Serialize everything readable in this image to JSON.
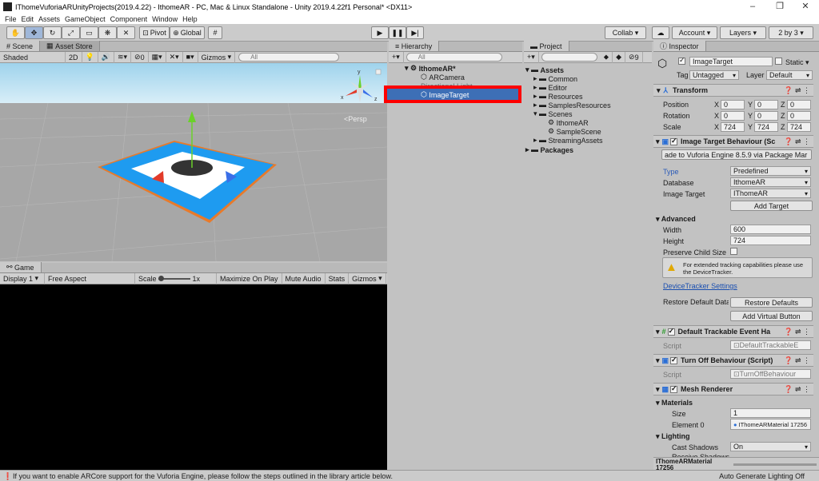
{
  "window": {
    "title": "IThomeVuforiaARUnityProjects(2019.4.22) - IthomeAR - PC, Mac & Linux Standalone - Unity 2019.4.22f1 Personal* <DX11>",
    "controls": [
      "–",
      "❐",
      "✕"
    ]
  },
  "menu": [
    "File",
    "Edit",
    "Assets",
    "GameObject",
    "Component",
    "Window",
    "Help"
  ],
  "toolbar": {
    "pivot": "Pivot",
    "global": "Global",
    "collab": "Collab ▾",
    "account": "Account",
    "layers": "Layers",
    "layout": "2 by 3"
  },
  "scene": {
    "tabs": [
      "Scene",
      "Asset Store"
    ],
    "shading": "Shaded",
    "mode2d": "2D",
    "gizmos": "Gizmos",
    "search_placeholder": "All",
    "persp": "<Persp",
    "fx_count": "0"
  },
  "game": {
    "tab": "Game",
    "display": "Display 1",
    "aspect": "Free Aspect",
    "scale_label": "Scale",
    "scale_value": "1x",
    "maximize": "Maximize On Play",
    "mute": "Mute Audio",
    "stats": "Stats",
    "gizmos": "Gizmos"
  },
  "hierarchy": {
    "tab": "Hierarchy",
    "search_placeholder": "All",
    "scene_name": "IthomeAR*",
    "items": [
      "ARCamera",
      "Directional Light",
      "ImageTarget"
    ]
  },
  "project": {
    "tab": "Project",
    "count": "9",
    "assets_label": "Assets",
    "folders": [
      "Common",
      "Editor",
      "Resources",
      "SamplesResources",
      "Scenes",
      "StreamingAssets"
    ],
    "scenes": [
      "IthomeAR",
      "SampleScene"
    ],
    "packages": "Packages"
  },
  "inspector": {
    "tab": "Inspector",
    "object_name": "ImageTarget",
    "static_label": "Static",
    "tag_label": "Tag",
    "tag_value": "Untagged",
    "layer_label": "Layer",
    "layer_value": "Default",
    "transform": {
      "title": "Transform",
      "rows": [
        {
          "label": "Position",
          "x": "0",
          "y": "0",
          "z": "0"
        },
        {
          "label": "Rotation",
          "x": "0",
          "y": "0",
          "z": "0"
        },
        {
          "label": "Scale",
          "x": "724",
          "y": "724",
          "z": "724"
        }
      ]
    },
    "itb": {
      "title": "Image Target Behaviour (Sc",
      "upgrade_text": "ade to Vuforia Engine 8.5.9 via Package Mar",
      "type_label": "Type",
      "type_value": "Predefined",
      "database_label": "Database",
      "database_value": "IthomeAR",
      "image_target_label": "Image Target",
      "image_target_value": "IThomeAR",
      "add_target": "Add Target",
      "advanced": "Advanced",
      "width_label": "Width",
      "width_value": "600",
      "height_label": "Height",
      "height_value": "724",
      "preserve_label": "Preserve Child Size",
      "warning": "For extended tracking capabilities please use the DeviceTracker.",
      "device_tracker_link": "DeviceTracker Settings",
      "restore_label": "Restore Default Data",
      "restore_button": "Restore Defaults",
      "add_virtual_button": "Add Virtual Button"
    },
    "dteh": {
      "title": "Default Trackable Event Ha",
      "script_label": "Script",
      "script_value": "DefaultTrackableE"
    },
    "tob": {
      "title": "Turn Off Behaviour (Script)",
      "script_label": "Script",
      "script_value": "TurnOffBehaviour"
    },
    "mesh": {
      "title": "Mesh Renderer",
      "materials": "Materials",
      "size_label": "Size",
      "size_value": "1",
      "element_label": "Element 0",
      "element_value": "IThomeARMaterial 17256",
      "lighting": "Lighting",
      "cast_label": "Cast Shadows",
      "cast_value": "On",
      "receive_label": "Receive Shadows",
      "material_footer": "IThomeARMaterial 17256"
    }
  },
  "status": {
    "message": "If you want to enable ARCore support for the Vuforia Engine, please follow the steps outlined in the library article below.",
    "right": "Auto Generate Lighting Off"
  },
  "colors": {
    "selection": "#3d6fb6",
    "highlight_border": "#ff0000",
    "target_blue": "#1e9bf0",
    "target_orange": "#e87a2a"
  }
}
